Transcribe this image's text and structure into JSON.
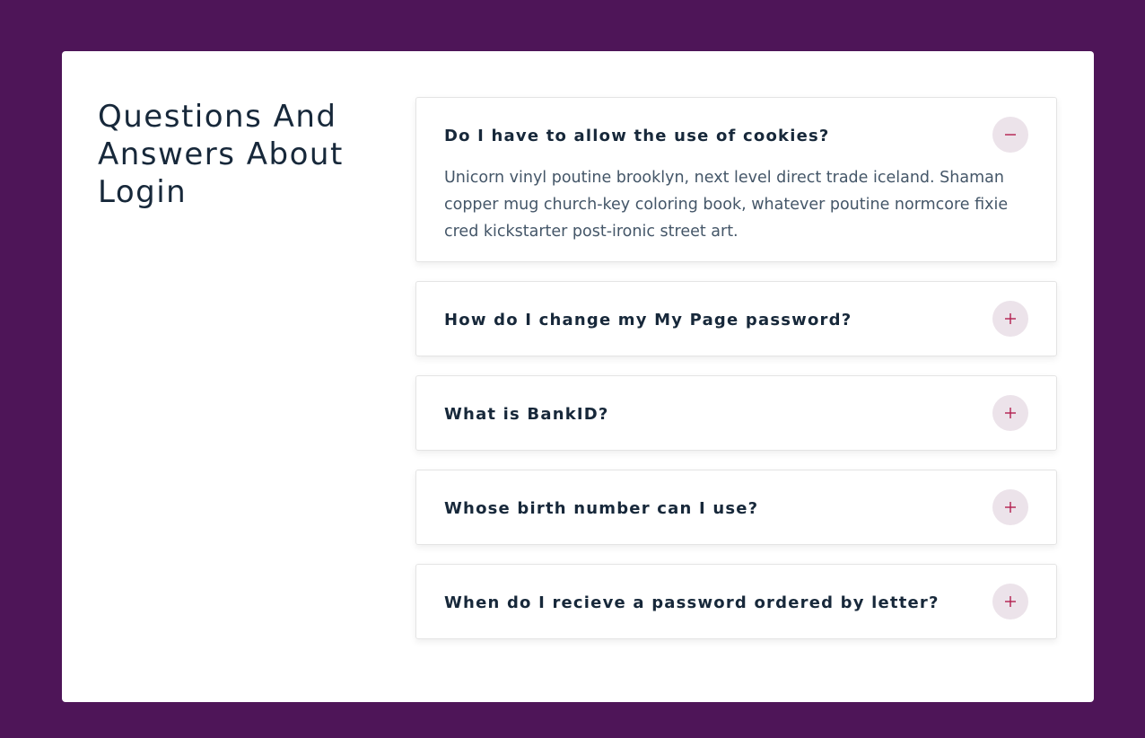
{
  "faq": {
    "heading": "Questions And Answers About Login",
    "items": [
      {
        "question": "Do I have to allow the use of cookies?",
        "answer": "Unicorn vinyl poutine brooklyn, next level direct trade iceland. Shaman copper mug church-key coloring book, whatever poutine normcore fixie cred kickstarter post-ironic street art.",
        "expanded": true,
        "toggle_icon": "minus-icon"
      },
      {
        "question": "How do I change my My Page password?",
        "expanded": false,
        "toggle_icon": "plus-icon"
      },
      {
        "question": "What is BankID?",
        "expanded": false,
        "toggle_icon": "plus-icon"
      },
      {
        "question": "Whose birth number can I use?",
        "expanded": false,
        "toggle_icon": "plus-icon"
      },
      {
        "question": "When do I recieve a password ordered by letter?",
        "expanded": false,
        "toggle_icon": "plus-icon"
      }
    ]
  },
  "colors": {
    "page_background": "#4e1558",
    "card_background": "#ffffff",
    "heading_text": "#17283a",
    "answer_text": "#445668",
    "toggle_background": "#ece3ea",
    "toggle_icon": "#b3204f"
  }
}
